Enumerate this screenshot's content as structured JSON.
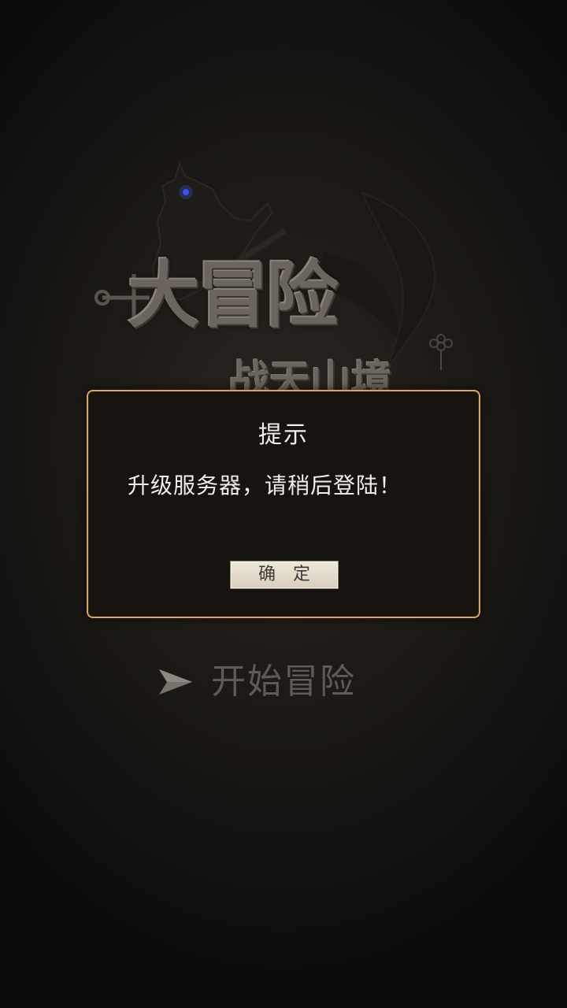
{
  "game": {
    "logo_main": "大冒险",
    "logo_sub": "战天山境"
  },
  "dialog": {
    "title": "提示",
    "message": "升级服务器，请稍后登陆！",
    "confirm_label": "确定"
  },
  "start": {
    "label": "开始冒险",
    "icon": "arrow-icon"
  },
  "colors": {
    "dialog_border": "#d7a563",
    "dialog_bg": "#17140f",
    "button_bg": "#e6ddcf"
  }
}
